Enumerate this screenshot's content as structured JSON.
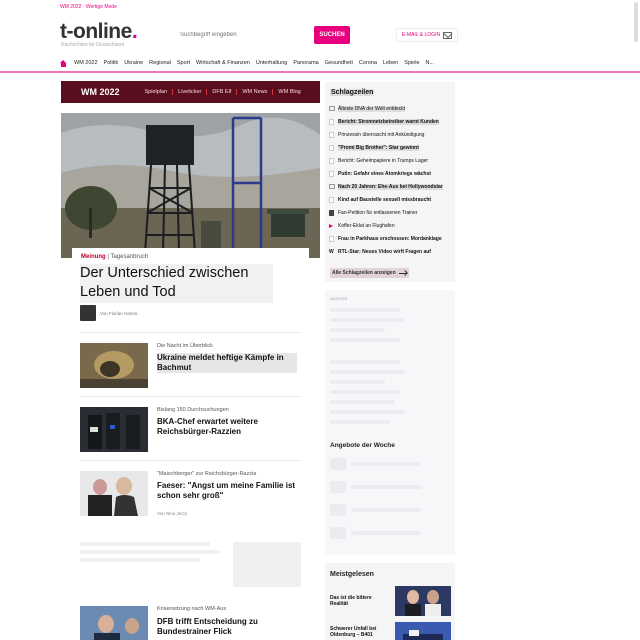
{
  "topstrip": {
    "hot": "WM 2022 · Wertige Mode"
  },
  "header": {
    "logo_main": "t-online",
    "logo_dot": ".",
    "tagline": "Nachrichten für Deutschland",
    "search_placeholder": "Suchbegriff eingeben",
    "search_label": "SUCHEN",
    "email_label": "E-MAIL & LOGIN"
  },
  "nav": {
    "items": [
      "WM 2022",
      "Politik",
      "Ukraine",
      "Regional",
      "Sport",
      "Wirtschaft & Finanzen",
      "Unterhaltung",
      "Panorama",
      "Gesundheit",
      "Corona",
      "Leben",
      "Spiele",
      "N..."
    ]
  },
  "wm": {
    "title": "WM 2022",
    "links": [
      "Spielplan",
      "Liveticker",
      "DFB Elf",
      "WM News",
      "WM Blog"
    ]
  },
  "lead": {
    "kicker_section": "Meinung",
    "kicker_sep": " | ",
    "kicker_type": "Tagesanbruch",
    "headline": "Der Unterschied zwischen Leben und Tod",
    "author": "Von Florian Harms"
  },
  "stories": [
    {
      "kicker": "Die Nacht im Überblick",
      "headline": "Ukraine meldet heftige Kämpfe in Bachmut",
      "author": ""
    },
    {
      "kicker": "Bislang 150 Durchsuchungen",
      "headline": "BKA-Chef erwartet weitere Reichsbürger-Razzien",
      "author": ""
    },
    {
      "kicker": "\"Maischberger\" zur Reichsbürger-Razzia",
      "headline": "Faeser: \"Angst um meine Familie ist schon sehr groß\"",
      "author": "Von Nina Jerzy"
    },
    {
      "kicker": "Krisensitzung nach WM-Aus",
      "headline": "DFB trifft Entscheidung zu Bundestrainer Flick",
      "author": ""
    }
  ],
  "schlagzeilen": {
    "title": "Schlagzeilen",
    "items": [
      {
        "text": "Älteste DNA der Welt entdeckt",
        "bold": false,
        "hl": true,
        "icon": "image-icon"
      },
      {
        "text": "Bericht: Stromnetzbetreiber warnt Kunden",
        "bold": true,
        "hl": true,
        "icon": "doc-icon"
      },
      {
        "text": "Prinzessin überrascht mit Ankündigung",
        "bold": false,
        "hl": false,
        "icon": "doc-icon"
      },
      {
        "text": "\"Promi Big Brother\": Star gewinnt",
        "bold": true,
        "hl": true,
        "icon": "doc-icon"
      },
      {
        "text": "Bericht: Geheimpapiere in Trumps Lager",
        "bold": false,
        "hl": false,
        "icon": "doc-icon"
      },
      {
        "text": "Putin: Gefahr eines Atomkriegs wächst",
        "bold": true,
        "hl": false,
        "icon": "doc-icon"
      },
      {
        "text": "Nach 20 Jahren: Ehe-Aus bei Hollywoodstar",
        "bold": true,
        "hl": true,
        "icon": "image-icon"
      },
      {
        "text": "Kind auf Baustelle sexuell missbraucht",
        "bold": true,
        "hl": false,
        "icon": "doc-icon"
      },
      {
        "text": "Fan-Petition für entlassenen Trainer",
        "bold": false,
        "hl": false,
        "icon": "gallery-icon"
      },
      {
        "text": "Koffer-Eklat an Flughafen",
        "bold": false,
        "hl": false,
        "icon": "play-icon"
      },
      {
        "text": "Frau in Parkhaus erschossen: Mordanklage",
        "bold": true,
        "hl": false,
        "icon": "doc-icon"
      },
      {
        "text": "RTL-Star: Neues Video wirft Fragen auf",
        "bold": true,
        "hl": false,
        "icon": "w-icon"
      }
    ],
    "all_label": "Alle Schlagzeilen anzeigen"
  },
  "ad": {
    "label": "ANZEIGE",
    "angebote": "Angebote der Woche"
  },
  "meistgelesen": {
    "title": "Meistgelesen",
    "items": [
      "Das ist die bittere Realität",
      "Schwerer Unfall bei Oldenburg – B401"
    ]
  },
  "colors": {
    "brand": "#e6007e",
    "wm_bar": "#5a0d1c",
    "meinung": "#c0002a"
  }
}
